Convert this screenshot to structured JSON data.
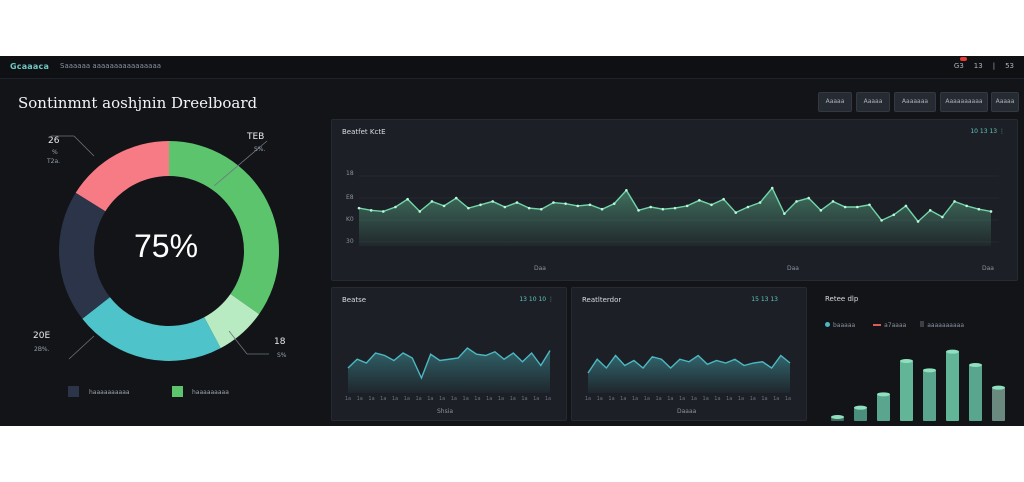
{
  "topbar": {
    "brand": "Gcaaaca",
    "nav": "Saaaaaa aaaaaaaaaaaaaaaa",
    "right": [
      "G3",
      "13",
      "|",
      "53"
    ]
  },
  "title": "Sontinmnt aoshjnin Dreelboard",
  "toolbar": {
    "buttons": [
      "Aaaaa",
      "Aaaaa",
      "Aaaaaaa",
      "Aaaaaaaaaa",
      "Aaaaa"
    ]
  },
  "donut": {
    "center_label": "75%",
    "top_left_value": "26",
    "top_left_sub1": "%",
    "top_left_sub2": "T2a.",
    "top_right_value": "TEB",
    "top_right_sub": "S%.",
    "bottom_left_value": "20E",
    "bottom_left_sub": "2B%.",
    "bottom_right_value": "18",
    "bottom_right_sub": "S%",
    "legend": [
      "haaaaaaaaaa",
      "haaaaaaaaa"
    ],
    "colors": {
      "green": "#5dc46e",
      "pink": "#f77b84",
      "navy": "#2b3448",
      "teal": "#4ec3c9",
      "light_green": "#b9ebc2"
    }
  },
  "chart_data": [
    {
      "type": "area",
      "title": "Beatfet KctE",
      "controls": "10 13 13 ⋮",
      "yticks": [
        "18",
        "E8",
        "K0",
        "30"
      ],
      "x_ticks": [
        "Daa",
        "Daa",
        "Daa"
      ],
      "values": [
        54,
        52,
        51,
        55,
        62,
        51,
        60,
        56,
        63,
        54,
        57,
        60,
        55,
        59,
        54,
        53,
        59,
        58,
        56,
        57,
        53,
        58,
        70,
        52,
        55,
        53,
        54,
        56,
        61,
        57,
        62,
        50,
        55,
        59,
        72,
        49,
        60,
        63,
        52,
        60,
        55,
        55,
        57,
        43,
        48,
        56,
        42,
        52,
        46,
        60,
        56,
        53,
        51
      ],
      "color": "#6fd6a8"
    },
    {
      "type": "area",
      "title": "Beatse",
      "controls": "13 10 10 ⋮",
      "x_ticks": [
        "1a",
        "1a",
        "1a",
        "1a",
        "1a",
        "1a",
        "1a",
        "1a",
        "1a",
        "1a",
        "1a",
        "1a",
        "1a",
        "1a",
        "1a",
        "1a",
        "1a",
        "1a"
      ],
      "xlabel": "Shsia",
      "values": [
        40,
        47,
        44,
        52,
        50,
        46,
        52,
        48,
        32,
        51,
        46,
        47,
        48,
        56,
        51,
        50,
        53,
        47,
        52,
        45,
        52,
        42,
        54
      ],
      "color": "#4cb8c2"
    },
    {
      "type": "area",
      "title": "Reatlterdor",
      "controls": "15 13 13",
      "x_ticks": [
        "1a",
        "1a",
        "1a",
        "1a",
        "1a",
        "1a",
        "1a",
        "1a",
        "1a",
        "1a",
        "1a",
        "1a",
        "1a",
        "1a",
        "1a",
        "1a",
        "1a",
        "1a"
      ],
      "xlabel": "Daaaa",
      "values": [
        36,
        47,
        40,
        50,
        42,
        46,
        40,
        49,
        47,
        40,
        47,
        45,
        50,
        43,
        46,
        44,
        47,
        42,
        44,
        45,
        40,
        50,
        44
      ],
      "color": "#4cb8c2"
    },
    {
      "type": "bar",
      "title": "Retee dlp",
      "legend": [
        "baaaaa",
        "a7aaaa",
        "aaaaaaaaaa"
      ],
      "values": [
        3,
        10,
        20,
        45,
        38,
        52,
        42,
        25
      ],
      "colors": [
        "#3a6b5e",
        "#4a8f7c",
        "#5aa58e",
        "#63b597",
        "#5aa58e",
        "#63b597",
        "#5aa58e",
        "#6a8a80"
      ]
    }
  ]
}
